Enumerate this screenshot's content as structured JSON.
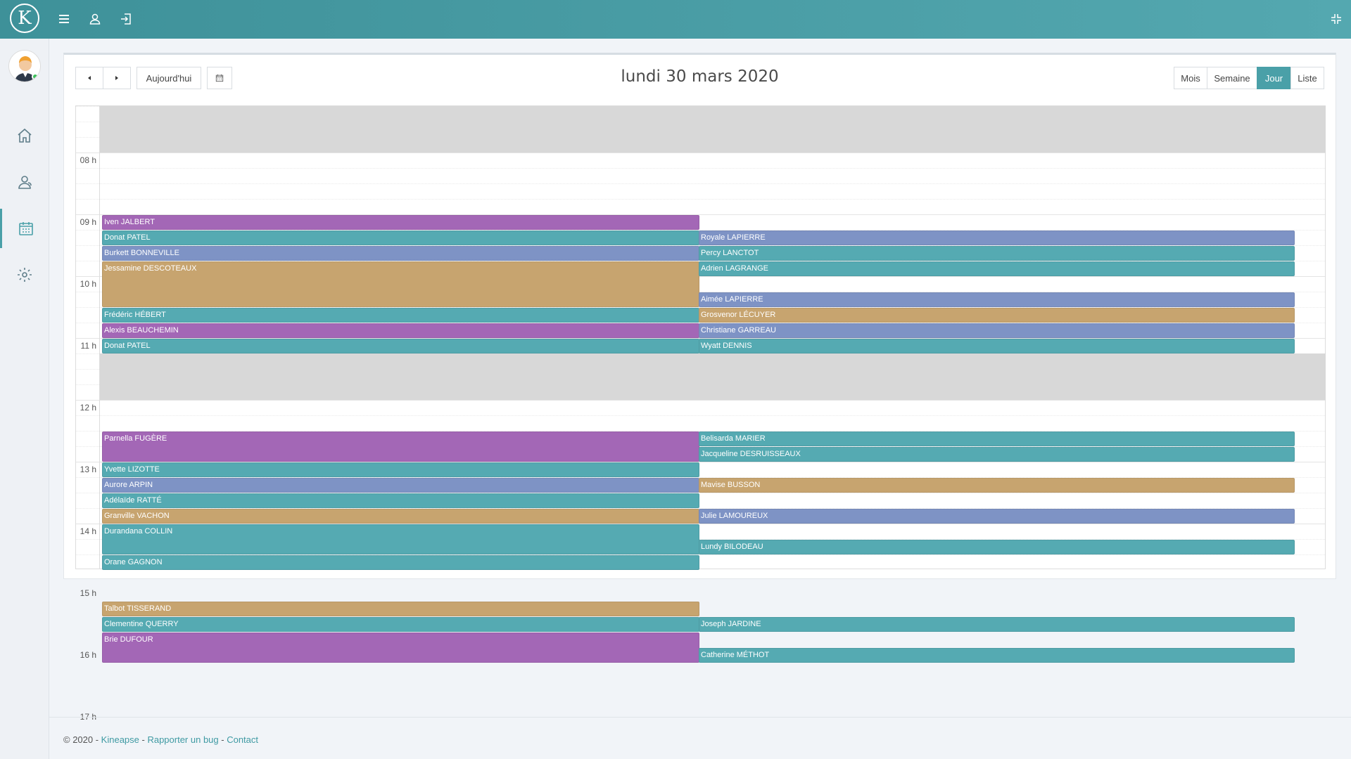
{
  "topbar": {
    "logo_letter": "K",
    "icons": [
      "menu-icon",
      "user-icon",
      "logout-icon",
      "compress-icon"
    ]
  },
  "sidebar": {
    "items": [
      "home-icon",
      "patients-icon",
      "calendar-icon",
      "settings-icon"
    ],
    "active": "calendar-icon"
  },
  "toolbar": {
    "today_label": "Aujourd'hui",
    "title": "lundi 30 mars 2020",
    "views": [
      "Mois",
      "Semaine",
      "Jour",
      "Liste"
    ],
    "active_view": "Jour"
  },
  "hours": [
    "08 h",
    "09 h",
    "10 h",
    "11 h",
    "12 h",
    "13 h",
    "14 h",
    "15 h",
    "16 h",
    "17 h"
  ],
  "colors": {
    "purple": "#a367b6",
    "teal": "#55aab2",
    "blue": "#7e93c5",
    "tan": "#c7a46f",
    "accent": "#4aa0a8"
  },
  "events": [
    {
      "name": "Iven JALBERT",
      "col": 0,
      "start": "09:00",
      "end": "09:15",
      "color": "purple"
    },
    {
      "name": "Donat PATEL",
      "col": 0,
      "start": "09:15",
      "end": "09:30",
      "color": "teal"
    },
    {
      "name": "Burkett BONNEVILLE",
      "col": 0,
      "start": "09:30",
      "end": "09:45",
      "color": "blue"
    },
    {
      "name": "Jessamine DESCOTEAUX",
      "col": 0,
      "start": "09:45",
      "end": "10:30",
      "color": "tan"
    },
    {
      "name": "Frédéric HÉBERT",
      "col": 0,
      "start": "10:30",
      "end": "10:45",
      "color": "teal"
    },
    {
      "name": "Alexis BEAUCHEMIN",
      "col": 0,
      "start": "10:45",
      "end": "11:00",
      "color": "purple"
    },
    {
      "name": "Donat PATEL",
      "col": 0,
      "start": "11:00",
      "end": "11:15",
      "color": "teal"
    },
    {
      "name": "Parnella FUGÈRE",
      "col": 0,
      "start": "12:30",
      "end": "13:00",
      "color": "purple"
    },
    {
      "name": "Yvette LIZOTTE",
      "col": 0,
      "start": "13:00",
      "end": "13:15",
      "color": "teal"
    },
    {
      "name": "Aurore ARPIN",
      "col": 0,
      "start": "13:15",
      "end": "13:30",
      "color": "blue"
    },
    {
      "name": "Adélaïde RATTÉ",
      "col": 0,
      "start": "13:30",
      "end": "13:45",
      "color": "teal"
    },
    {
      "name": "Granville VACHON",
      "col": 0,
      "start": "13:45",
      "end": "14:00",
      "color": "tan"
    },
    {
      "name": "Durandana COLLIN",
      "col": 0,
      "start": "14:00",
      "end": "14:30",
      "color": "teal"
    },
    {
      "name": "Orane GAGNON",
      "col": 0,
      "start": "14:30",
      "end": "14:45",
      "color": "teal"
    },
    {
      "name": "Talbot TISSERAND",
      "col": 0,
      "start": "15:15",
      "end": "15:30",
      "color": "tan"
    },
    {
      "name": "Clementine QUERRY",
      "col": 0,
      "start": "15:30",
      "end": "15:45",
      "color": "teal"
    },
    {
      "name": "Brie DUFOUR",
      "col": 0,
      "start": "15:45",
      "end": "16:15",
      "color": "purple"
    },
    {
      "name": "Royale LAPIERRE",
      "col": 1,
      "start": "09:15",
      "end": "09:30",
      "color": "blue"
    },
    {
      "name": "Percy LANCTOT",
      "col": 1,
      "start": "09:30",
      "end": "09:45",
      "color": "teal"
    },
    {
      "name": "Adrien LAGRANGE",
      "col": 1,
      "start": "09:45",
      "end": "10:00",
      "color": "teal"
    },
    {
      "name": "Aimée LAPIERRE",
      "col": 1,
      "start": "10:15",
      "end": "10:30",
      "color": "blue"
    },
    {
      "name": "Grosvenor LÉCUYER",
      "col": 1,
      "start": "10:30",
      "end": "10:45",
      "color": "tan"
    },
    {
      "name": "Christiane GARREAU",
      "col": 1,
      "start": "10:45",
      "end": "11:00",
      "color": "blue"
    },
    {
      "name": "Wyatt DENNIS",
      "col": 1,
      "start": "11:00",
      "end": "11:15",
      "color": "teal"
    },
    {
      "name": "Belisarda MARIER",
      "col": 1,
      "start": "12:30",
      "end": "12:45",
      "color": "teal"
    },
    {
      "name": "Jacqueline DESRUISSEAUX",
      "col": 1,
      "start": "12:45",
      "end": "13:00",
      "color": "teal"
    },
    {
      "name": "Mavise BUSSON",
      "col": 1,
      "start": "13:15",
      "end": "13:30",
      "color": "tan"
    },
    {
      "name": "Julie LAMOUREUX",
      "col": 1,
      "start": "13:45",
      "end": "14:00",
      "color": "blue"
    },
    {
      "name": "Lundy BILODEAU",
      "col": 1,
      "start": "14:15",
      "end": "14:30",
      "color": "teal"
    },
    {
      "name": "Joseph JARDINE",
      "col": 1,
      "start": "15:30",
      "end": "15:45",
      "color": "teal"
    },
    {
      "name": "Catherine MÉTHOT",
      "col": 1,
      "start": "16:00",
      "end": "16:15",
      "color": "teal"
    }
  ],
  "closed_ranges": [
    {
      "start": "07:15",
      "end": "08:00"
    },
    {
      "start": "11:15",
      "end": "12:00"
    }
  ],
  "footer": {
    "copyright": "© 2020 - ",
    "brand": "Kineapse",
    "sep1": " - ",
    "bug": "Rapporter un bug",
    "sep2": " - ",
    "contact": "Contact"
  }
}
